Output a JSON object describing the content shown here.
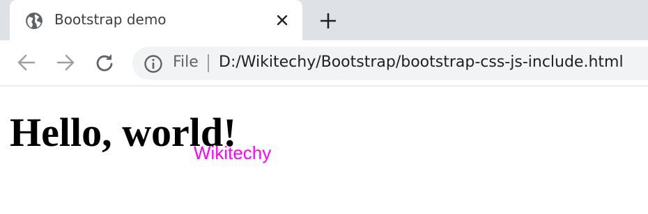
{
  "tab": {
    "title": "Bootstrap demo",
    "icon": "globe-icon"
  },
  "toolbar": {
    "back_icon": "arrow-left-icon",
    "forward_icon": "arrow-right-icon",
    "reload_icon": "reload-icon"
  },
  "omnibox": {
    "scheme_label": "File",
    "url": "D:/Wikitechy/Bootstrap/bootstrap-css-js-include.html",
    "info_icon": "info-icon"
  },
  "page": {
    "heading": "Hello, world!",
    "brand_text": "Wikitechy",
    "brand_color": "#ff00ff"
  },
  "colors": {
    "tabstrip_bg": "#dee1e6",
    "omnibox_bg": "#f1f3f4",
    "icon_gray": "#5f6368",
    "disabled_gray": "#9aa0a6"
  }
}
